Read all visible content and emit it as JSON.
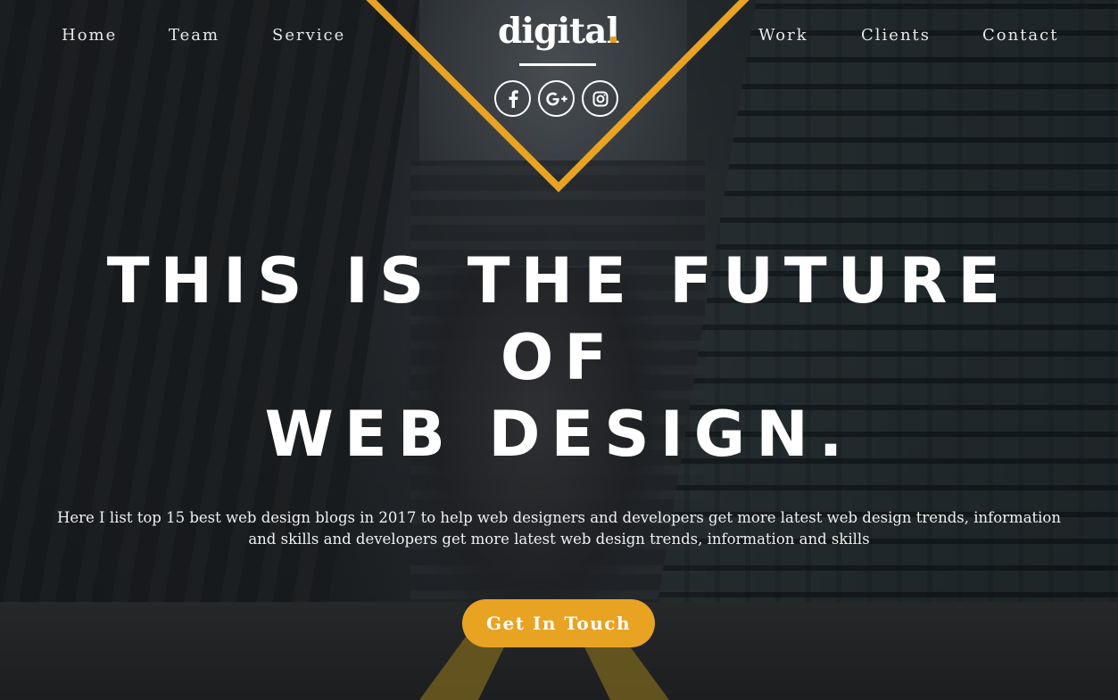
{
  "nav": {
    "left": [
      "Home",
      "Team",
      "Service"
    ],
    "right": [
      "Work",
      "Clients",
      "Contact"
    ]
  },
  "logo": {
    "text": "digital"
  },
  "social": [
    {
      "name": "facebook-icon"
    },
    {
      "name": "google-plus-icon"
    },
    {
      "name": "instagram-icon"
    }
  ],
  "hero": {
    "line1": "THIS IS THE FUTURE",
    "line2": "OF",
    "line3": "WEB DESIGN.",
    "description": "Here I list top 15 best web design blogs in 2017 to help web designers and developers get more latest web design trends, information and skills and developers get more latest web design trends, information and skills",
    "cta_label": "Get In Touch"
  },
  "colors": {
    "accent": "#e8a323",
    "text": "#ffffff",
    "overlay": "#0a0c0e"
  }
}
